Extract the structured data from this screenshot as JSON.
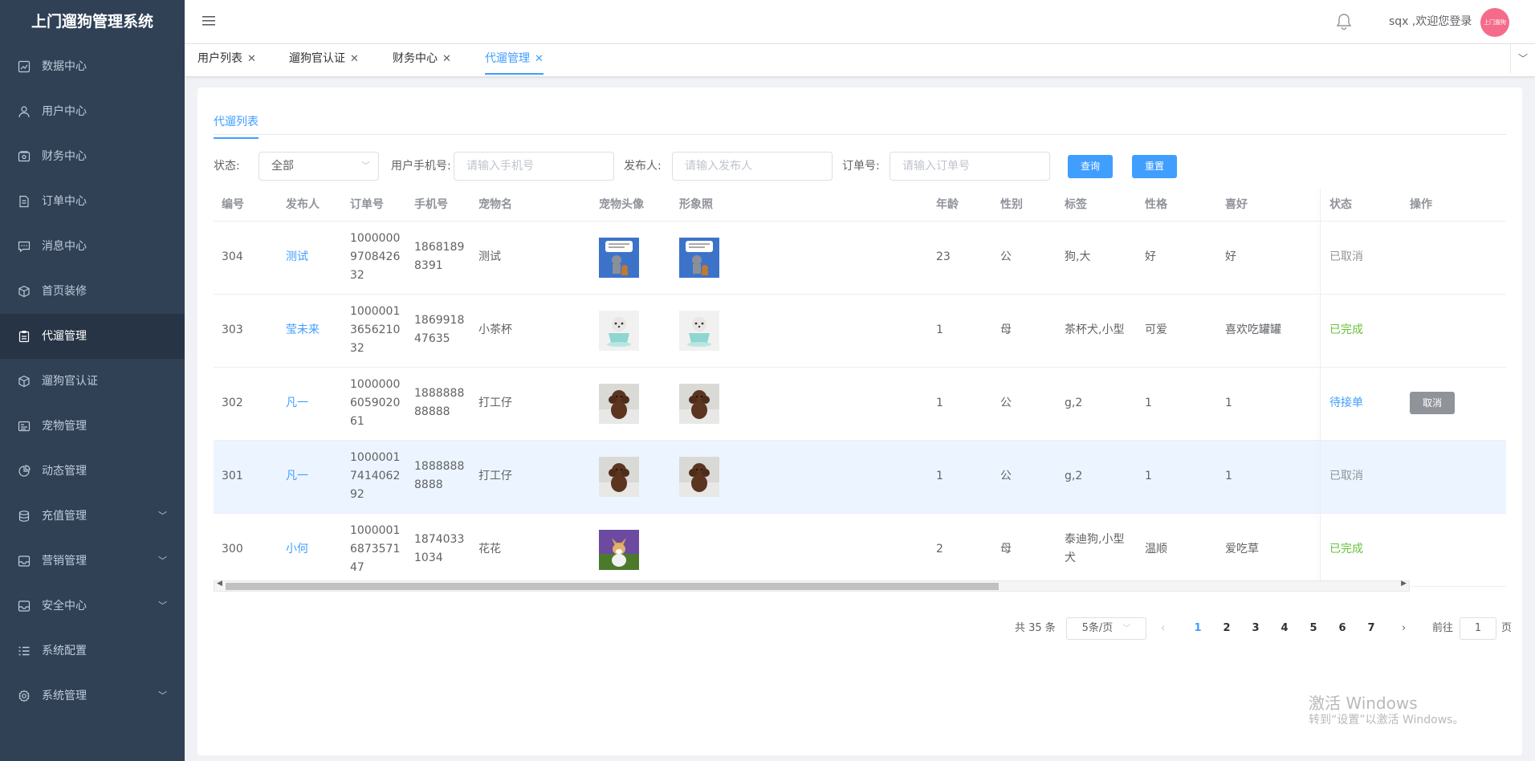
{
  "app": {
    "title": "上门遛狗管理系统"
  },
  "sidebar": {
    "items": [
      {
        "label": "数据中心",
        "icon": "chart-icon"
      },
      {
        "label": "用户中心",
        "icon": "user-icon"
      },
      {
        "label": "财务中心",
        "icon": "wallet-icon"
      },
      {
        "label": "订单中心",
        "icon": "document-icon"
      },
      {
        "label": "消息中心",
        "icon": "message-icon"
      },
      {
        "label": "首页装修",
        "icon": "box-icon"
      },
      {
        "label": "代遛管理",
        "icon": "clipboard-icon",
        "active": true
      },
      {
        "label": "遛狗官认证",
        "icon": "box-icon"
      },
      {
        "label": "宠物管理",
        "icon": "card-icon"
      },
      {
        "label": "动态管理",
        "icon": "pie-icon"
      },
      {
        "label": "充值管理",
        "icon": "coins-icon",
        "expandable": true
      },
      {
        "label": "营销管理",
        "icon": "tray-icon",
        "expandable": true
      },
      {
        "label": "安全中心",
        "icon": "tray-icon",
        "expandable": true
      },
      {
        "label": "系统配置",
        "icon": "list-icon"
      },
      {
        "label": "系统管理",
        "icon": "gear-icon",
        "expandable": true
      }
    ]
  },
  "header": {
    "welcome": "sqx ,欢迎您登录",
    "avatar_text": "上门遛狗"
  },
  "tags": [
    {
      "label": "用户列表"
    },
    {
      "label": "遛狗官认证"
    },
    {
      "label": "财务中心"
    },
    {
      "label": "代遛管理",
      "active": true
    }
  ],
  "page": {
    "subtab": "代遛列表",
    "filters": {
      "status_label": "状态:",
      "status_value": "全部",
      "phone_label": "用户手机号:",
      "phone_placeholder": "请输入手机号",
      "publisher_label": "发布人:",
      "publisher_placeholder": "请输入发布人",
      "order_label": "订单号:",
      "order_placeholder": "请输入订单号",
      "search_button": "查询",
      "reset_button": "重置"
    },
    "table": {
      "columns": [
        "编号",
        "发布人",
        "订单号",
        "手机号",
        "宠物名",
        "宠物头像",
        "形象照",
        "年龄",
        "性别",
        "标签",
        "性格",
        "喜好",
        "状态",
        "操作"
      ],
      "rows": [
        {
          "id": "304",
          "publisher": "测试",
          "order": "100000097084263 2",
          "order_lines": [
            "1000000",
            "9708426",
            "32"
          ],
          "phone_lines": [
            "1868189",
            "8391"
          ],
          "pet": "测试",
          "avatar": "cartoon",
          "photo": "cartoon",
          "age": "23",
          "gender": "公",
          "tags_lines": [
            "狗,大"
          ],
          "personality": "好",
          "hobby": "好",
          "status": "已取消",
          "status_type": "cancel"
        },
        {
          "id": "303",
          "publisher": "莹未来",
          "order_lines": [
            "1000001",
            "3656210",
            "32"
          ],
          "phone_lines": [
            "1869918",
            "47635"
          ],
          "pet": "小茶杯",
          "avatar": "teacup",
          "photo": "teacup",
          "age": "1",
          "gender": "母",
          "tags_lines": [
            "茶杯犬,小型"
          ],
          "personality": "可爱",
          "hobby": "喜欢吃罐罐",
          "status": "已完成",
          "status_type": "done"
        },
        {
          "id": "302",
          "publisher": "凡一",
          "order_lines": [
            "1000000",
            "6059020",
            "61"
          ],
          "phone_lines": [
            "1888888",
            "88888"
          ],
          "pet": "打工仔",
          "avatar": "poodle",
          "photo": "poodle",
          "age": "1",
          "gender": "公",
          "tags_lines": [
            "g,2"
          ],
          "personality": "1",
          "hobby": "1",
          "status": "待接单",
          "status_type": "wait",
          "action": "取消"
        },
        {
          "id": "301",
          "publisher": "凡一",
          "order_lines": [
            "1000001",
            "7414062",
            "92"
          ],
          "phone_lines": [
            "1888888",
            "8888"
          ],
          "pet": "打工仔",
          "avatar": "poodle",
          "photo": "poodle",
          "age": "1",
          "gender": "公",
          "tags_lines": [
            "g,2"
          ],
          "personality": "1",
          "hobby": "1",
          "status": "已取消",
          "status_type": "cancel",
          "highlight": true
        },
        {
          "id": "300",
          "publisher": "小何",
          "order_lines": [
            "1000001",
            "6873571",
            "47"
          ],
          "phone_lines": [
            "1874033",
            "1034"
          ],
          "pet": "花花",
          "avatar": "corgi",
          "photo": "",
          "age": "2",
          "gender": "母",
          "tags_lines": [
            "泰迪狗,小型",
            "犬"
          ],
          "personality": "温顺",
          "hobby": "爱吃草",
          "status": "已完成",
          "status_type": "done"
        }
      ]
    },
    "pagination": {
      "total": "共 35 条",
      "page_size": "5条/页",
      "pages": [
        "1",
        "2",
        "3",
        "4",
        "5",
        "6",
        "7"
      ],
      "current": "1",
      "goto_label": "前往",
      "goto_value": "1",
      "page_suffix": "页"
    }
  },
  "watermark": {
    "line1": "激活 Windows",
    "line2": "转到“设置”以激活 Windows。"
  },
  "colors": {
    "sidebar": "#304156",
    "accent": "#409eff",
    "success": "#67c23a",
    "muted": "#909399"
  }
}
